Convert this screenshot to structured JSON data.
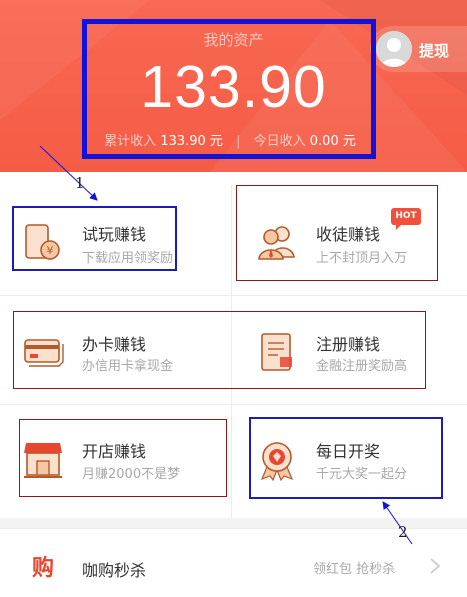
{
  "header": {
    "asset_label": "我的资产",
    "asset_value": "133.90",
    "total_label": "累计收入",
    "total_value": "133.90 元",
    "separator": "|",
    "today_label": "今日收入",
    "today_value": "0.00 元",
    "withdraw_label": "提现"
  },
  "grid": [
    {
      "title": "试玩赚钱",
      "subtitle": "下载应用领奖励",
      "icon": "phone-coin-icon"
    },
    {
      "title": "收徒赚钱",
      "subtitle": "上不封顶月入万",
      "icon": "users-icon",
      "badge": "HOT"
    },
    {
      "title": "办卡赚钱",
      "subtitle": "办信用卡拿现金",
      "icon": "credit-card-icon"
    },
    {
      "title": "注册赚钱",
      "subtitle": "金融注册奖励高",
      "icon": "document-icon"
    },
    {
      "title": "开店赚钱",
      "subtitle": "月赚2000不是梦",
      "icon": "shop-icon"
    },
    {
      "title": "每日开奖",
      "subtitle": "千元大奖一起分",
      "icon": "medal-icon"
    }
  ],
  "flash_sale": {
    "logo_text": "购",
    "title": "咖购秒杀",
    "right_text": "领红包 抢秒杀",
    "icon": "chevron-right-icon"
  },
  "annotations": {
    "label_1": "1",
    "label_2": "2"
  },
  "colors": {
    "header": "#f55c46",
    "accent": "#e8462f",
    "icon_orange": "#f2a36b",
    "hot_badge": "#f0503c",
    "annotation_blue": "#1212d8",
    "annotation_red": "#8a1a1a"
  }
}
